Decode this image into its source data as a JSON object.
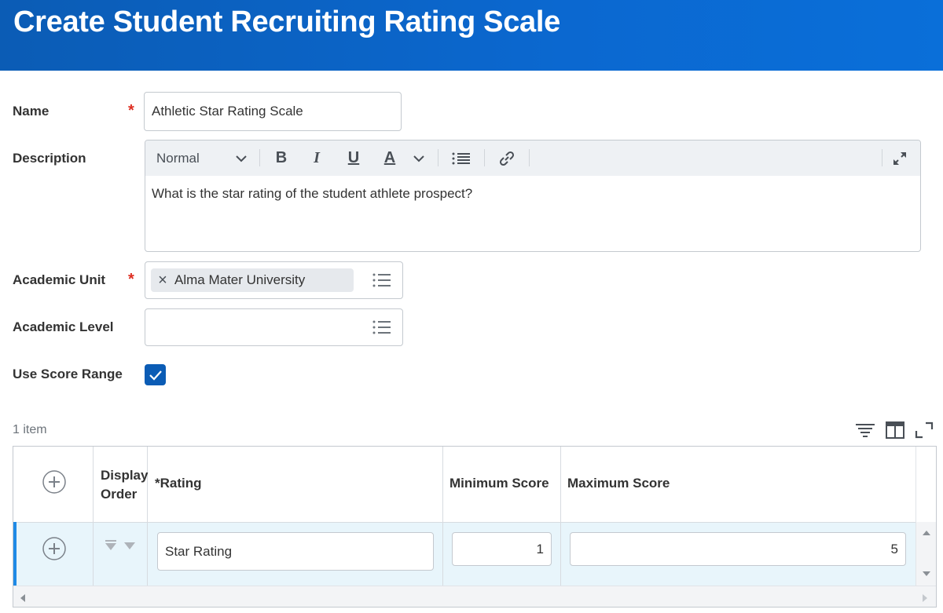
{
  "header": {
    "title": "Create Student Recruiting Rating Scale"
  },
  "form": {
    "name": {
      "label": "Name",
      "required_mark": "*",
      "value": "Athletic Star Rating Scale"
    },
    "description": {
      "label": "Description",
      "toolbar": {
        "style_select": "Normal",
        "bold": "B",
        "italic": "I",
        "underline": "U",
        "color": "A"
      },
      "value": "What is the star rating of the student athlete prospect?"
    },
    "academic_unit": {
      "label": "Academic Unit",
      "required_mark": "*",
      "selected": "Alma Mater University",
      "remove_glyph": "×"
    },
    "academic_level": {
      "label": "Academic Level",
      "value": ""
    },
    "use_score_range": {
      "label": "Use Score Range",
      "checked": true
    }
  },
  "grid": {
    "count_label": "1 item",
    "columns": {
      "display_order_line1": "Display",
      "display_order_line2": "Order",
      "rating": "*Rating",
      "minimum_score": "Minimum Score",
      "maximum_score": "Maximum Score"
    },
    "rows": [
      {
        "rating": "Star Rating",
        "minimum_score": "1",
        "maximum_score": "5"
      }
    ]
  },
  "colors": {
    "header": "#0b5cb5",
    "required": "#de2e21",
    "checkbox": "#0b5cb5",
    "row_highlight": "#e8f5fb",
    "row_accent": "#1f8ae6"
  }
}
